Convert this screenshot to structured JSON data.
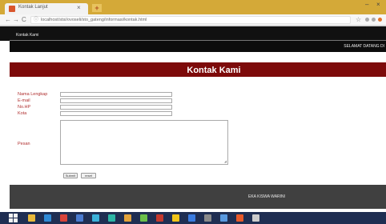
{
  "browser": {
    "tab_title": "Kontak Lanjut",
    "tab_close": "×",
    "new_tab": "+",
    "url": "localhost/stsi/ovoseli/sto_gateng/informasi/kontak.html",
    "window_min": "–",
    "window_close": "×",
    "nav": {
      "back": "←",
      "forward": "→",
      "reload": "C",
      "info": "ⓘ"
    },
    "star": "☆"
  },
  "page": {
    "topnav_link": "Kontak Kami",
    "welcome": "SELAMAT DATANG DI",
    "title": "Kontak Kami"
  },
  "form": {
    "labels": {
      "full_name": "Nama Lengkap",
      "email": "E-mail",
      "phone": "No.HP",
      "city": "Kota",
      "message": "Pesan"
    },
    "submit_label": "Submit",
    "reset_label": "reset",
    "resize_grip": "◢"
  },
  "footer": {
    "text": "EKA KISWA WARINI"
  },
  "taskbar": {
    "tray": "",
    "icons": [
      {
        "name": "file-explorer-icon",
        "color": "#e8b93b"
      },
      {
        "name": "media-icon",
        "color": "#2f8ad6"
      },
      {
        "name": "chrome-icon",
        "color": "#d9443a"
      },
      {
        "name": "app-icon",
        "color": "#4a7bd1"
      },
      {
        "name": "settings-icon",
        "color": "#3bb1d9"
      },
      {
        "name": "browser-icon",
        "color": "#2cb5a5"
      },
      {
        "name": "folder-icon",
        "color": "#e2a23a"
      },
      {
        "name": "app-icon",
        "color": "#6cc04a"
      },
      {
        "name": "app-icon",
        "color": "#c5392e"
      },
      {
        "name": "app-icon",
        "color": "#f0c419"
      },
      {
        "name": "app-icon",
        "color": "#3a7be0"
      },
      {
        "name": "app-icon",
        "color": "#8a8a8a"
      },
      {
        "name": "app-icon",
        "color": "#5a9ae0"
      },
      {
        "name": "app-icon",
        "color": "#e85a2a"
      },
      {
        "name": "app-icon",
        "color": "#cccccc"
      }
    ]
  }
}
